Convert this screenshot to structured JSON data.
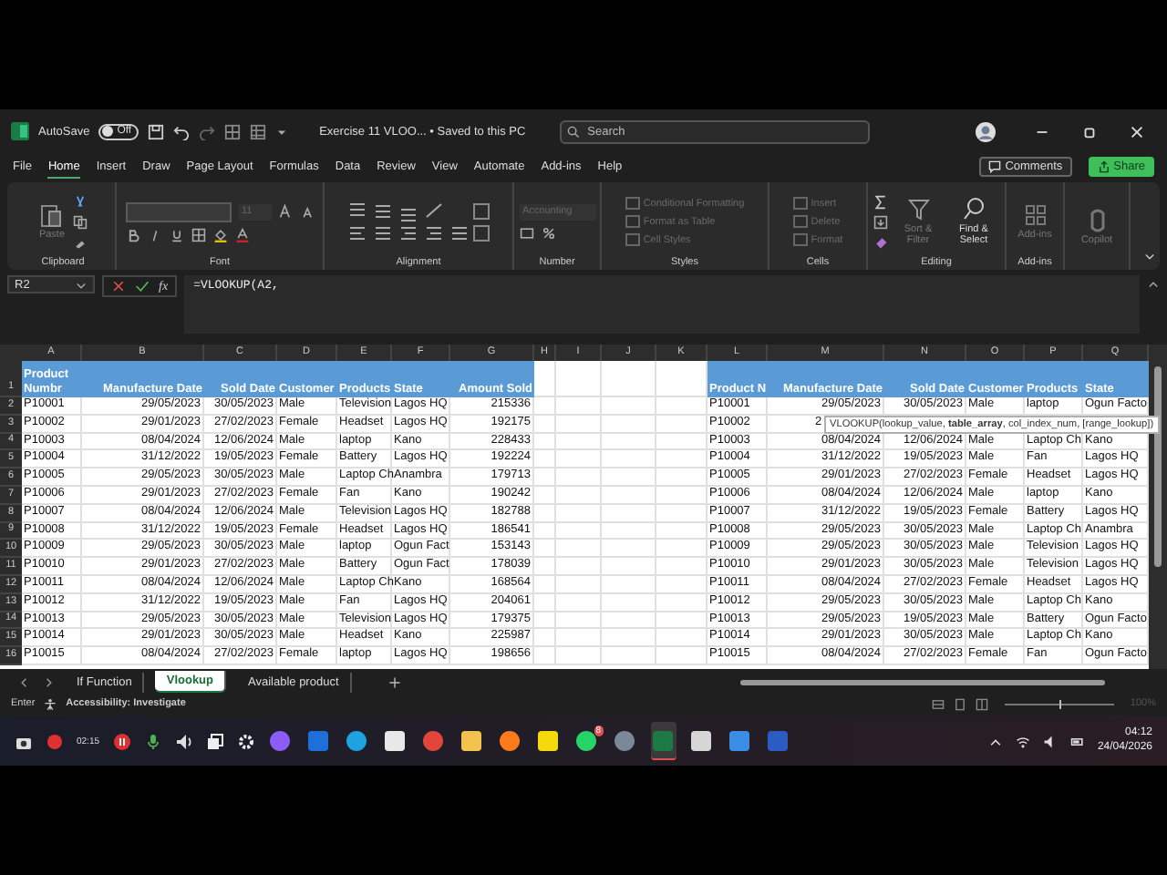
{
  "title_bar": {
    "autosave_label": "AutoSave",
    "autosave_state": "Off",
    "autosave_on": false,
    "title": "Exercise 11 VLOO... • Saved to this PC",
    "search_placeholder": "Search"
  },
  "menu": {
    "tabs": [
      {
        "label": "File",
        "selected": false
      },
      {
        "label": "Home",
        "selected": true
      },
      {
        "label": "Insert",
        "selected": false
      },
      {
        "label": "Draw",
        "selected": false
      },
      {
        "label": "Page Layout",
        "selected": false
      },
      {
        "label": "Formulas",
        "selected": false
      },
      {
        "label": "Data",
        "selected": false
      },
      {
        "label": "Review",
        "selected": false
      },
      {
        "label": "View",
        "selected": false
      },
      {
        "label": "Automate",
        "selected": false
      },
      {
        "label": "Add-ins",
        "selected": false
      },
      {
        "label": "Help",
        "selected": false
      }
    ],
    "comments": "Comments",
    "share": "Share"
  },
  "ribbon": {
    "clipboard": {
      "label": "Clipboard",
      "paste": {
        "label": "Paste",
        "disabled": true
      }
    },
    "font": {
      "label": "Font",
      "size": "11"
    },
    "alignment": {
      "label": "Alignment"
    },
    "number": {
      "label": "Number",
      "format": "Accounting"
    },
    "styles": {
      "label": "Styles",
      "items": [
        {
          "label": "Conditional Formatting",
          "disabled": true
        },
        {
          "label": "Format as Table",
          "disabled": true
        },
        {
          "label": "Cell Styles",
          "disabled": true
        }
      ]
    },
    "cells": {
      "label": "Cells",
      "items": [
        {
          "label": "Insert",
          "disabled": true
        },
        {
          "label": "Delete",
          "disabled": true
        },
        {
          "label": "Format",
          "disabled": true
        }
      ]
    },
    "editing": {
      "label": "Editing",
      "items": [
        {
          "label": "Sort & Filter",
          "disabled": true
        },
        {
          "label": "Find & Select",
          "disabled": false
        }
      ]
    },
    "addins": {
      "label": "Add-ins",
      "items": [
        {
          "label": "Add-ins",
          "disabled": true
        }
      ]
    },
    "copilot": {
      "items": [
        {
          "label": "Copilot",
          "disabled": true
        }
      ]
    }
  },
  "formula_bar": {
    "name_box": "R2",
    "fx": "fx",
    "formula": "=VLOOKUP(A2,"
  },
  "sheet": {
    "row_numbers": [
      "1",
      "2",
      "3",
      "4",
      "5",
      "6",
      "7",
      "8",
      "9",
      "10",
      "11",
      "12",
      "13",
      "14",
      "15",
      "16"
    ],
    "column_letters": [
      "A",
      "B",
      "C",
      "D",
      "E",
      "F",
      "G",
      "H",
      "I",
      "J",
      "K",
      "L",
      "M",
      "N",
      "O",
      "P",
      "Q"
    ],
    "left_table": {
      "columns": [
        "Product Numbr",
        "Manufacture Date",
        "Sold Date",
        "Customer",
        "Products",
        "State",
        "Amount Sold"
      ],
      "rows": [
        [
          "P10001",
          "29/05/2023",
          "30/05/2023",
          "Male",
          "Television",
          "Lagos HQ",
          "215336"
        ],
        [
          "P10002",
          "29/01/2023",
          "27/02/2023",
          "Female",
          "Headset",
          "Lagos HQ",
          "192175"
        ],
        [
          "P10003",
          "08/04/2024",
          "12/06/2024",
          "Male",
          "laptop",
          "Kano",
          "228433"
        ],
        [
          "P10004",
          "31/12/2022",
          "19/05/2023",
          "Female",
          "Battery",
          "Lagos HQ",
          "192224"
        ],
        [
          "P10005",
          "29/05/2023",
          "30/05/2023",
          "Male",
          "Laptop Ch",
          "Anambra",
          "179713"
        ],
        [
          "P10006",
          "29/01/2023",
          "27/02/2023",
          "Female",
          "Fan",
          "Kano",
          "190242"
        ],
        [
          "P10007",
          "08/04/2024",
          "12/06/2024",
          "Male",
          "Television",
          "Lagos HQ",
          "182788"
        ],
        [
          "P10008",
          "31/12/2022",
          "19/05/2023",
          "Female",
          "Headset",
          "Lagos HQ",
          "186541"
        ],
        [
          "P10009",
          "29/05/2023",
          "30/05/2023",
          "Male",
          "laptop",
          "Ogun Fact",
          "153143"
        ],
        [
          "P10010",
          "29/01/2023",
          "27/02/2023",
          "Male",
          "Battery",
          "Ogun Fact",
          "178039"
        ],
        [
          "P10011",
          "08/04/2024",
          "12/06/2024",
          "Male",
          "Laptop Ch",
          "Kano",
          "168564"
        ],
        [
          "P10012",
          "31/12/2022",
          "19/05/2023",
          "Male",
          "Fan",
          "Lagos HQ",
          "204061"
        ],
        [
          "P10013",
          "29/05/2023",
          "30/05/2023",
          "Male",
          "Television",
          "Lagos HQ",
          "179375"
        ],
        [
          "P10014",
          "29/01/2023",
          "30/05/2023",
          "Male",
          "Headset",
          "Kano",
          "225987"
        ],
        [
          "P10015",
          "08/04/2024",
          "27/02/2023",
          "Female",
          "laptop",
          "Lagos HQ",
          "198656"
        ]
      ]
    },
    "right_table": {
      "columns": [
        "Product N",
        "Manufacture Date",
        "Sold Date",
        "Customer",
        "Products",
        "State"
      ],
      "rows": [
        [
          "P10001",
          "29/05/2023",
          "30/05/2023",
          "Male",
          "laptop",
          "Ogun Facto"
        ],
        [
          "P10002",
          "2"
        ],
        [
          "P10003",
          "08/04/2024",
          "12/06/2024",
          "Male",
          "Laptop Ch",
          "Kano"
        ],
        [
          "P10004",
          "31/12/2022",
          "19/05/2023",
          "Male",
          "Fan",
          "Lagos HQ"
        ],
        [
          "P10005",
          "29/01/2023",
          "27/02/2023",
          "Female",
          "Headset",
          "Lagos HQ"
        ],
        [
          "P10006",
          "08/04/2024",
          "12/06/2024",
          "Male",
          "laptop",
          "Kano"
        ],
        [
          "P10007",
          "31/12/2022",
          "19/05/2023",
          "Female",
          "Battery",
          "Lagos HQ"
        ],
        [
          "P10008",
          "29/05/2023",
          "30/05/2023",
          "Male",
          "Laptop Ch",
          "Anambra"
        ],
        [
          "P10009",
          "29/05/2023",
          "30/05/2023",
          "Male",
          "Television",
          "Lagos HQ"
        ],
        [
          "P10010",
          "29/01/2023",
          "30/05/2023",
          "Male",
          "Television",
          "Lagos HQ"
        ],
        [
          "P10011",
          "08/04/2024",
          "27/02/2023",
          "Female",
          "Headset",
          "Lagos HQ"
        ],
        [
          "P10012",
          "29/05/2023",
          "30/05/2023",
          "Male",
          "Laptop Ch",
          "Kano"
        ],
        [
          "P10013",
          "29/05/2023",
          "19/05/2023",
          "Male",
          "Battery",
          "Ogun Facto"
        ],
        [
          "P10014",
          "29/01/2023",
          "30/05/2023",
          "Male",
          "Laptop Ch",
          "Kano"
        ],
        [
          "P10015",
          "08/04/2024",
          "27/02/2023",
          "Female",
          "Fan",
          "Ogun Facto"
        ]
      ]
    },
    "tooltip": "VLOOKUP(lookup_value, **table_array**, col_index_num, [range_lookup])"
  },
  "sheet_tabs": [
    {
      "label": "If Function",
      "selected": false
    },
    {
      "label": "Vlookup",
      "selected": true
    },
    {
      "label": "Available product",
      "selected": false
    }
  ],
  "status_bar": {
    "mode": "Enter",
    "accessibility": "Accessibility: Investigate",
    "zoom": "100%",
    "zoom_slider": {
      "level": 0.5
    }
  },
  "taskbar": {
    "recorder_timer": "02:15",
    "apps": [
      {
        "selected": false
      },
      {
        "selected": false
      },
      {
        "selected": false
      },
      {
        "selected": false
      },
      {
        "selected": false
      },
      {
        "selected": false
      },
      {
        "selected": false
      },
      {
        "selected": false
      },
      {
        "selected": false,
        "badge": "8"
      },
      {
        "selected": false
      },
      {
        "selected": true
      },
      {
        "selected": false
      },
      {
        "selected": false
      },
      {
        "selected": false
      }
    ],
    "time": "04:12",
    "date": "24/04/2026"
  }
}
